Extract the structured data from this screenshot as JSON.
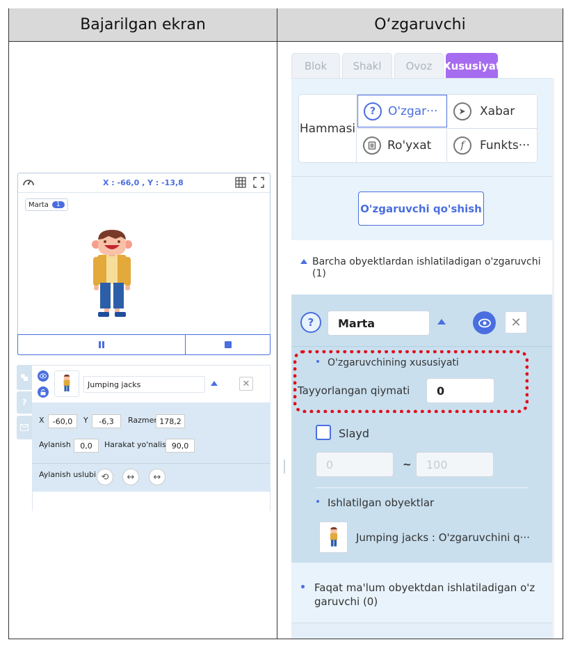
{
  "headers": {
    "left": "Bajarilgan ekran",
    "right": "O‘zgaruvchi"
  },
  "stage": {
    "coords": "X : -66,0 , Y : -13,8",
    "var_name": "Marta",
    "var_value": "1"
  },
  "object": {
    "name": "Jumping jacks",
    "x_label": "X",
    "x_value": "-60,0",
    "y_label": "Y",
    "y_value": "-6,3",
    "size_label": "Razmer",
    "size_value": "178,2",
    "rotation_label": "Aylanish",
    "rotation_value": "0,0",
    "direction_label": "Harakat yo'nalish",
    "direction_value": "90,0",
    "rotation_style_label": "Aylanish uslubi"
  },
  "tabs": [
    "Blok",
    "Shakl",
    "Ovoz",
    "Xususiyat"
  ],
  "categories": {
    "all": "Hammasi",
    "variable": "O'zgar···",
    "message": "Xabar",
    "list": "Ro'yxat",
    "function": "Funkts···"
  },
  "add_button": "O'zgaruvchi qo'shish",
  "global_section": "Barcha obyektlardan ishlatiladigan o'zgaruvchi (1)",
  "variable": {
    "name": "Marta",
    "props_title": "O'zgaruvchining xususiyati",
    "default_label": "Tayyorlangan qiymati",
    "default_value": "0",
    "slide_label": "Slayd",
    "min_placeholder": "0",
    "max_placeholder": "100",
    "range_sep": "~",
    "used_title": "Ishlatilgan obyektlar",
    "used_item": "Jumping jacks : O'zgaruvchini q···"
  },
  "local_section": "Faqat ma'lum obyektdan ishlatiladigan o'z garuvchi (0)",
  "colors": {
    "accent": "#4a6ee0",
    "active_tab": "#a66cf0",
    "highlight": "#e0101c",
    "panel_bg": "#e8f3fb",
    "var_bg": "#c9dfee"
  }
}
